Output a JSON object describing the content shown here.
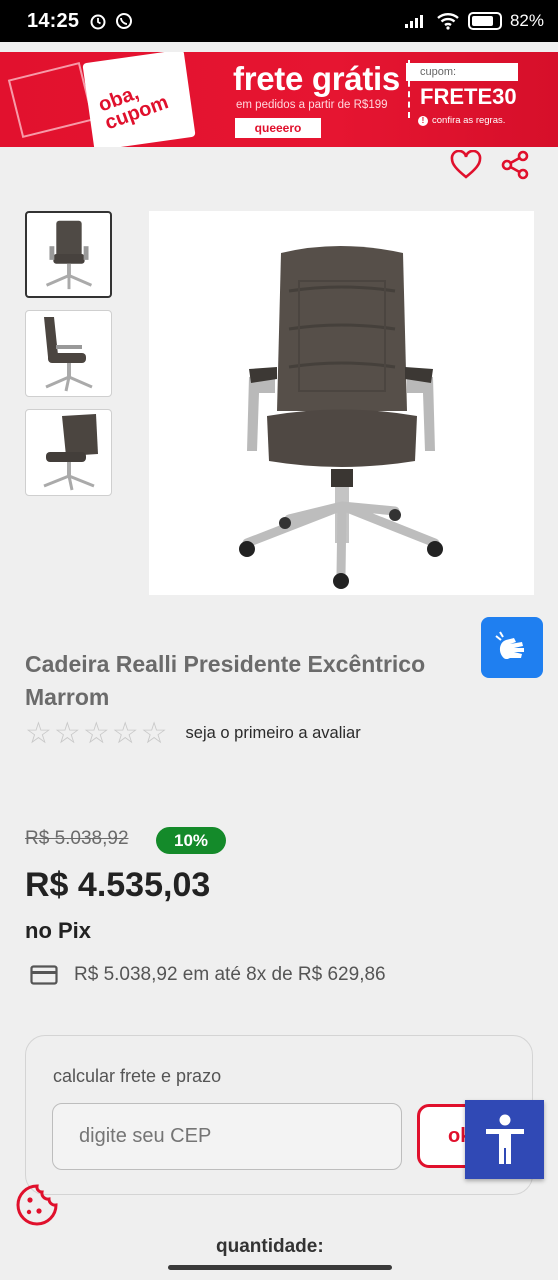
{
  "status_bar": {
    "time": "14:25",
    "battery": "82%",
    "battery_level": 0.82
  },
  "promo": {
    "ticket_text": "oba, cupom",
    "title": "frete grátis",
    "subtitle": "em pedidos a partir de R$199",
    "button_label": "queeero",
    "coupon_label": "cupom:",
    "coupon_code": "FRETE30",
    "rules_link": "confira as regras."
  },
  "product": {
    "title": "Cadeira Realli Presidente Excêntrico Marrom",
    "rating_text": "seja o primeiro a avaliar",
    "stars": 0,
    "old_price": "R$ 5.038,92",
    "discount": "10%",
    "price": "R$ 4.535,03",
    "price_suffix": "no Pix",
    "installments": "R$ 5.038,92 em até 8x de R$ 629,86"
  },
  "shipping": {
    "label": "calcular frete e prazo",
    "cep_placeholder": "digite seu CEP",
    "cep_value": "",
    "button_label": "ok"
  },
  "quantity_label": "quantidade:",
  "colors": {
    "brand_red": "#e0102c",
    "discount_green": "#148a2a",
    "accessibility_blue": "#1f7ff0",
    "accessibility_dark": "#3049b5"
  },
  "icons": [
    "whatsapp-icon",
    "alarm-icon",
    "signal-icon",
    "wifi-icon",
    "battery-icon",
    "heart-icon",
    "share-icon",
    "sign-language-icon",
    "credit-card-icon",
    "accessibility-icon",
    "cookie-icon"
  ]
}
